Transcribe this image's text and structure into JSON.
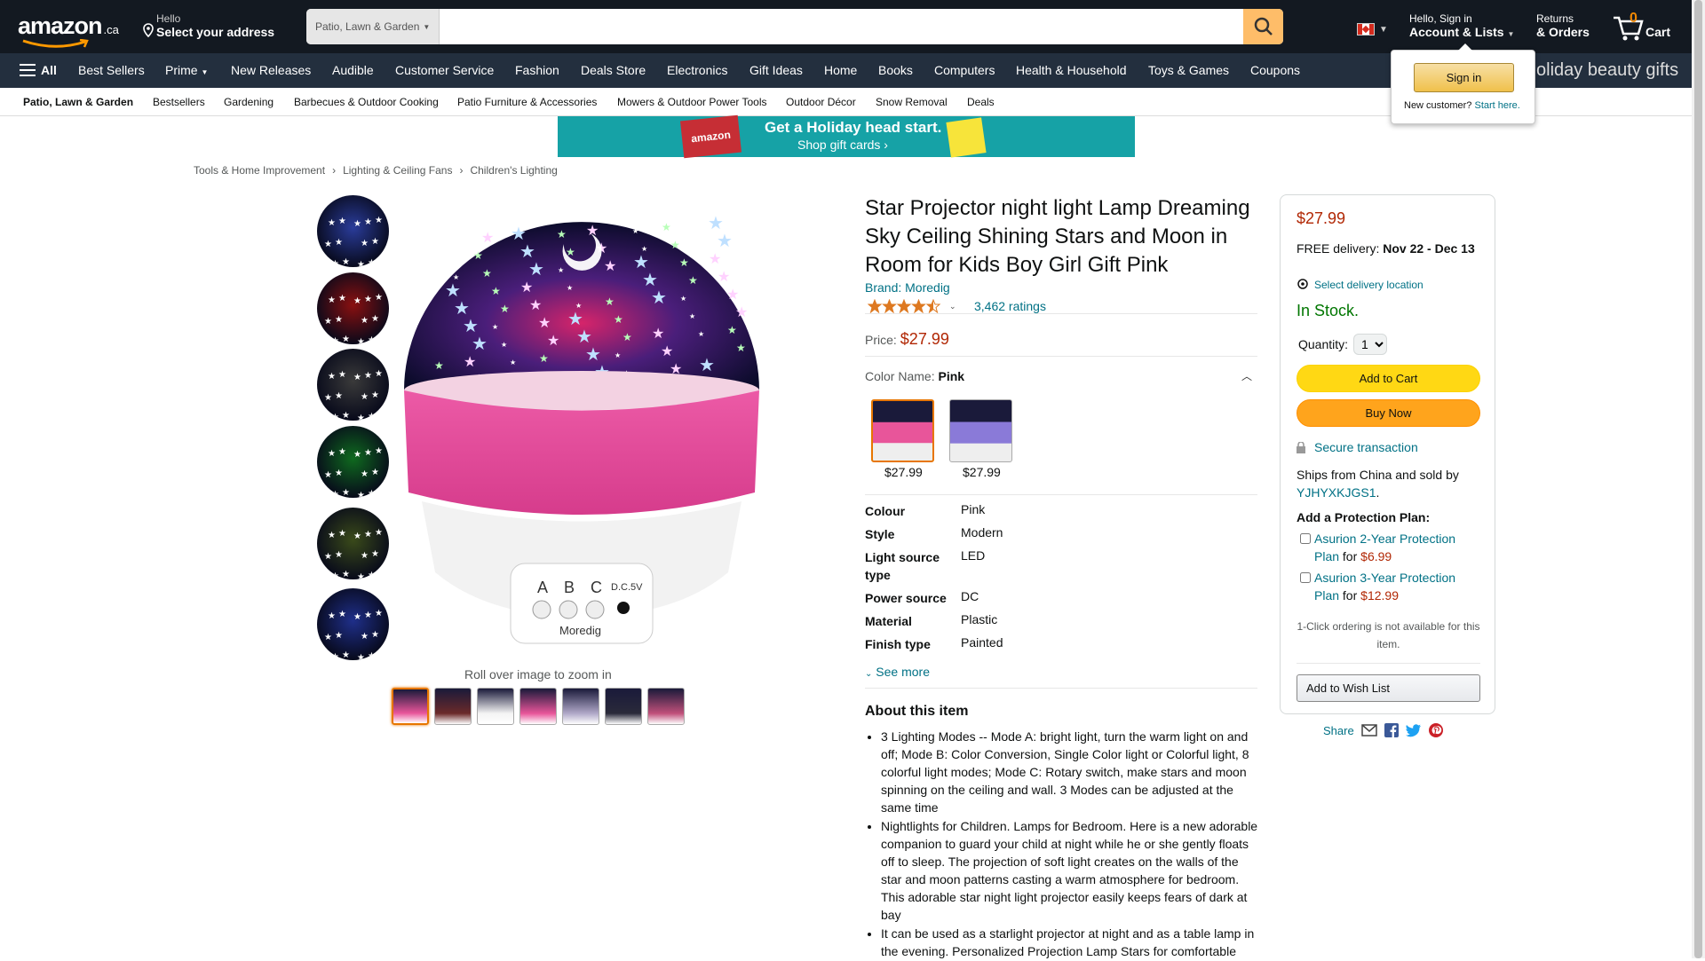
{
  "header": {
    "logo_word": "amazon",
    "logo_tld": ".ca",
    "address_line1": "Hello",
    "address_line2": "Select your address",
    "search_category": "Patio, Lawn & Garden",
    "search_placeholder": "",
    "account_line1": "Hello, Sign in",
    "account_line2": "Account & Lists",
    "orders_line1": "Returns",
    "orders_line2": "& Orders",
    "cart_count": "0",
    "cart_label": "Cart",
    "brand_color": "#131921",
    "search_button_color": "#febd69"
  },
  "nav": {
    "all_label": "All",
    "items": [
      "Best Sellers",
      "Prime",
      "New Releases",
      "Audible",
      "Customer Service",
      "Fashion",
      "Deals Store",
      "Electronics",
      "Gift Ideas",
      "Home",
      "Books",
      "Computers",
      "Health & Household",
      "Toys & Games",
      "Coupons"
    ],
    "promo_text": "oliday beauty gifts"
  },
  "subnav": {
    "items": [
      "Patio, Lawn & Garden",
      "Bestsellers",
      "Gardening",
      "Barbecues & Outdoor Cooking",
      "Patio Furniture & Accessories",
      "Mowers & Outdoor Power Tools",
      "Outdoor Décor",
      "Snow Removal",
      "Deals"
    ]
  },
  "banner": {
    "tag": "amazon",
    "line1": "Get a Holiday head start.",
    "line2": "Shop gift cards ›"
  },
  "breadcrumbs": [
    "Tools & Home Improvement",
    "Lighting & Ceiling Fans",
    "Children's Lighting"
  ],
  "signin_popover": {
    "button": "Sign in",
    "new_customer": "New customer?",
    "start_here": "Start here."
  },
  "gallery": {
    "zoom_hint": "Roll over image to zoom in",
    "vertical_thumb_colors": [
      "#2a3c9a",
      "#8a1010",
      "#3a3a3a",
      "#0f6a1f",
      "#3a4a1a",
      "#1f2f8a"
    ],
    "horizontal_thumb_colors": [
      "#e8559a",
      "#6b2a2a",
      "#f4f4f4",
      "#e8559a",
      "#b0a8c8",
      "#2a2a3a",
      "#c0507a"
    ],
    "selected_thumb_index": 0,
    "product_logo_text": "Moredig",
    "button_labels": [
      "A",
      "B",
      "C",
      "D.C.5V"
    ]
  },
  "product": {
    "title": "Star Projector night light Lamp Dreaming Sky Ceiling Shining Stars and Moon in Room for Kids Boy Girl Gift Pink",
    "brand": "Brand: Moredig",
    "rating": 4.5,
    "ratings_count": "3,462 ratings",
    "price_label": "Price:",
    "price": "$27.99",
    "color_label": "Color Name:",
    "color_value": "Pink",
    "swatches": [
      {
        "price": "$27.99",
        "color": "#e8559a"
      },
      {
        "price": "$27.99",
        "color": "#8a7ad8"
      }
    ],
    "specs": [
      {
        "key": "Colour",
        "value": "Pink"
      },
      {
        "key": "Style",
        "value": "Modern"
      },
      {
        "key": "Light source type",
        "value": "LED"
      },
      {
        "key": "Power source",
        "value": "DC"
      },
      {
        "key": "Material",
        "value": "Plastic"
      },
      {
        "key": "Finish type",
        "value": "Painted"
      }
    ],
    "see_more": "See more",
    "about_heading": "About this item",
    "bullets": [
      "3 Lighting Modes -- Mode A: bright light, turn the warm light on and off; Mode B: Color Conversion, Single Color light or Colorful light, 8 colorful light modes; Mode C: Rotary switch, make stars and moon spinning on the ceiling and wall. 3 Modes can be adjusted at the same time",
      "Nightlights for Children. Lamps for Bedroom. Here is a new adorable companion to guard your child at night while he or she gently floats off to sleep. The projection of soft light creates on the walls of the star and moon patterns casting a warm atmosphere for bedroom. This adorable star night light projector easily keeps fears of dark at bay",
      "It can be used as a starlight projector at night and as a table lamp in the evening. Personalized Projection Lamp Stars for comfortable"
    ]
  },
  "buybox": {
    "price": "$27.99",
    "delivery_prefix": "FREE delivery:",
    "delivery_dates": "Nov 22 - Dec 13",
    "location_link": "Select delivery location",
    "stock": "In Stock.",
    "qty_label": "Quantity:",
    "qty_value": "1",
    "add_to_cart": "Add to Cart",
    "buy_now": "Buy Now",
    "secure": "Secure transaction",
    "ships_text": "Ships from China and sold by",
    "seller": "YJHYXKJGS1",
    "plan_heading": "Add a Protection Plan:",
    "plans": [
      {
        "name": "Asurion 2-Year Protection Plan",
        "for": "for",
        "price": "$6.99"
      },
      {
        "name": "Asurion 3-Year Protection Plan",
        "for": "for",
        "price": "$12.99"
      }
    ],
    "one_click": "1-Click ordering is not available for this item.",
    "wish_list": "Add to Wish List",
    "share_label": "Share"
  }
}
